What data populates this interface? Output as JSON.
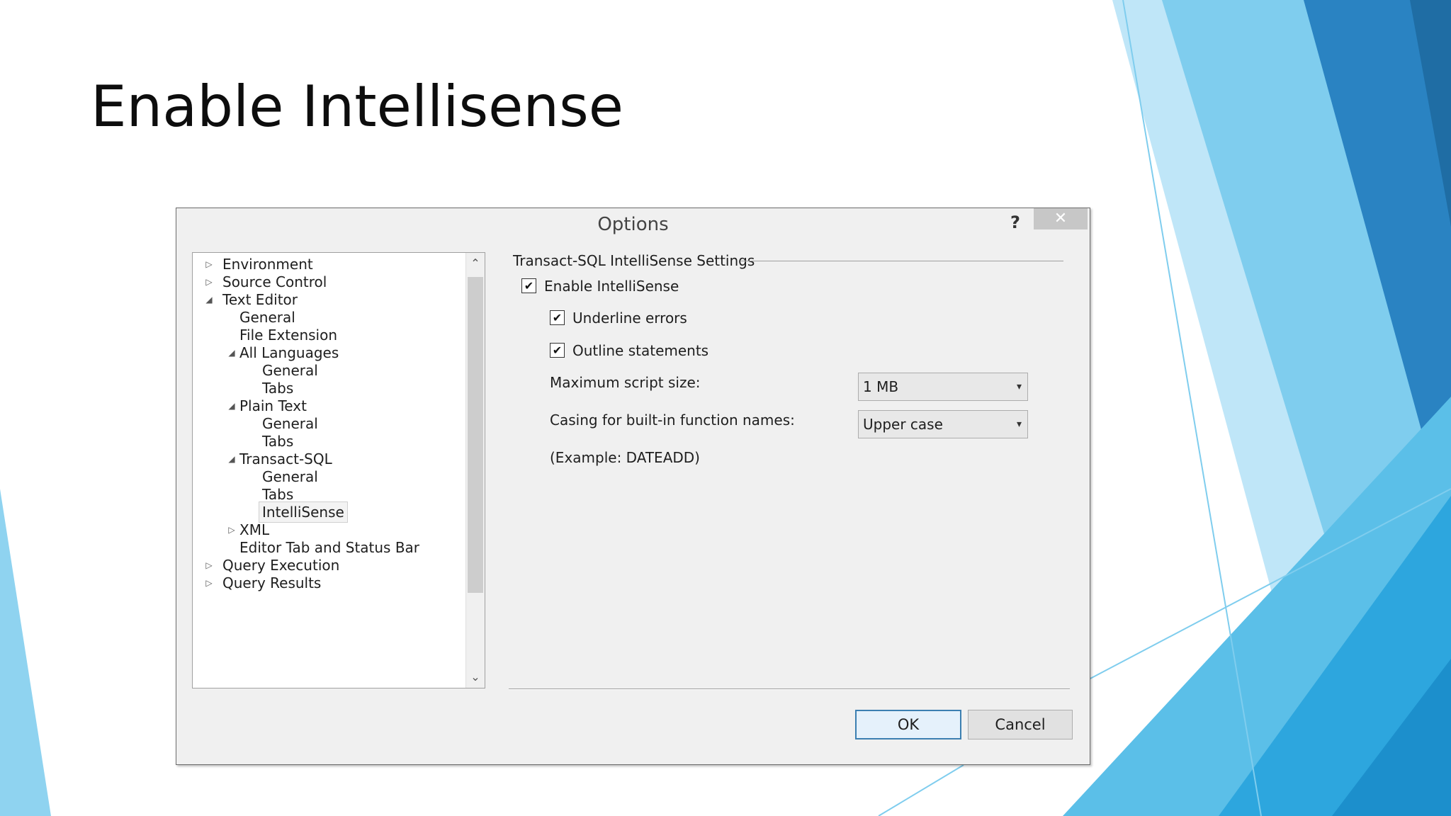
{
  "slide": {
    "title": "Enable Intellisense"
  },
  "dialog": {
    "title": "Options",
    "help_label": "?",
    "close_label": "✕",
    "tree": [
      {
        "label": "Environment",
        "arrow": "▷"
      },
      {
        "label": "Source Control",
        "arrow": "▷"
      },
      {
        "label": "Text Editor",
        "arrow": "◢"
      },
      {
        "label": "General",
        "arrow": ""
      },
      {
        "label": "File Extension",
        "arrow": ""
      },
      {
        "label": "All Languages",
        "arrow": "◢"
      },
      {
        "label": "General",
        "arrow": ""
      },
      {
        "label": "Tabs",
        "arrow": ""
      },
      {
        "label": "Plain Text",
        "arrow": "◢"
      },
      {
        "label": "General",
        "arrow": ""
      },
      {
        "label": "Tabs",
        "arrow": ""
      },
      {
        "label": "Transact-SQL",
        "arrow": "◢"
      },
      {
        "label": "General",
        "arrow": ""
      },
      {
        "label": "Tabs",
        "arrow": ""
      },
      {
        "label": "IntelliSense",
        "arrow": ""
      },
      {
        "label": "XML",
        "arrow": "▷"
      },
      {
        "label": "Editor Tab and Status Bar",
        "arrow": ""
      },
      {
        "label": "Query Execution",
        "arrow": "▷"
      },
      {
        "label": "Query Results",
        "arrow": "▷"
      }
    ],
    "scroll_up": "⌃",
    "scroll_down": "⌄",
    "settings": {
      "group_title": "Transact-SQL IntelliSense Settings",
      "enable_intellisense": {
        "label": "Enable IntelliSense",
        "checked": true
      },
      "underline_errors": {
        "label": "Underline errors",
        "checked": true
      },
      "outline_statements": {
        "label": "Outline statements",
        "checked": true
      },
      "max_script_size_label": "Maximum script size:",
      "max_script_size_value": "1  MB",
      "casing_label": "Casing for built-in function names:",
      "casing_value": "Upper case",
      "example_text": "(Example: DATEADD)",
      "check_mark": "✔",
      "dropdown_glyph": "▾"
    },
    "ok_label": "OK",
    "cancel_label": "Cancel"
  },
  "colors": {
    "accent_blue": "#3c7fb1",
    "deco_light": "#8fd3f0",
    "deco_mid": "#2ea7dd",
    "deco_dark": "#1c6ea6"
  }
}
